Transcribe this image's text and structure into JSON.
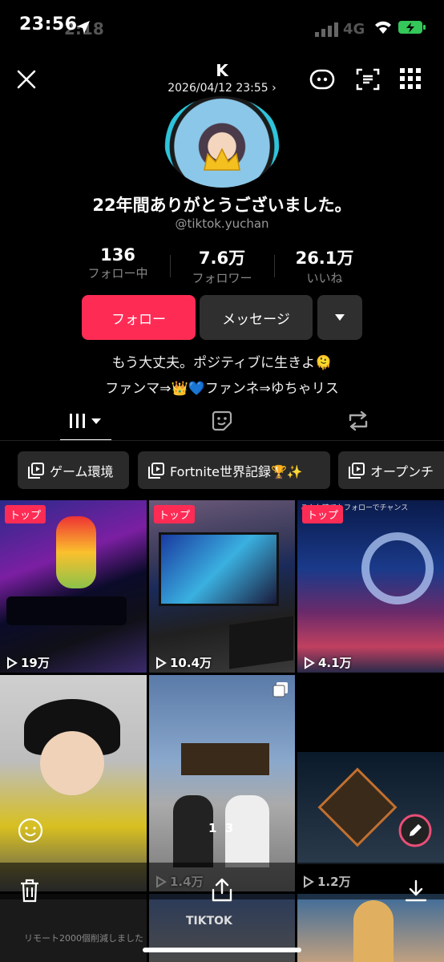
{
  "status_bar": {
    "time": "23:56",
    "ghost_time": "2:18",
    "network": "4G"
  },
  "header": {
    "name": "K",
    "datetime": "2026/04/12 23:55",
    "date_chevron": "›"
  },
  "profile": {
    "title": "22年間ありがとうございました。",
    "handle": "@tiktok.yuchan"
  },
  "stats": [
    {
      "value": "136",
      "label": "フォロー中"
    },
    {
      "value": "7.6万",
      "label": "フォロワー"
    },
    {
      "value": "26.1万",
      "label": "いいね"
    }
  ],
  "actions": {
    "follow": "フォロー",
    "message": "メッセージ"
  },
  "bio": {
    "line1": "もう大丈夫。ポジティブに生きよ🫠",
    "line2": "ファンマ⇒👑💙ファンネ⇒ゆちゃリス"
  },
  "playlists": [
    "ゲーム環境",
    "Fortnite世界記録🏆✨",
    "オープンチ"
  ],
  "videos": [
    {
      "badge": "トップ",
      "views": "19万"
    },
    {
      "badge": "トップ",
      "views": "10.4万"
    },
    {
      "badge": "トップ",
      "views": "4.1万"
    },
    {
      "badge": "",
      "views": ""
    },
    {
      "badge": "",
      "views": "1.4万"
    },
    {
      "badge": "",
      "views": "1.2万"
    }
  ],
  "overlay": {
    "photo_counter": "1  3",
    "tile_caption": "こんな時でもフォローでチャンス",
    "bottom_text": "リモート2000個削減しました",
    "sticker_text": "TIKTOK"
  },
  "colors": {
    "accent": "#fe2c55",
    "bg": "#000000",
    "chip": "#2a2a2a",
    "button_dark": "#2f2f2f"
  }
}
